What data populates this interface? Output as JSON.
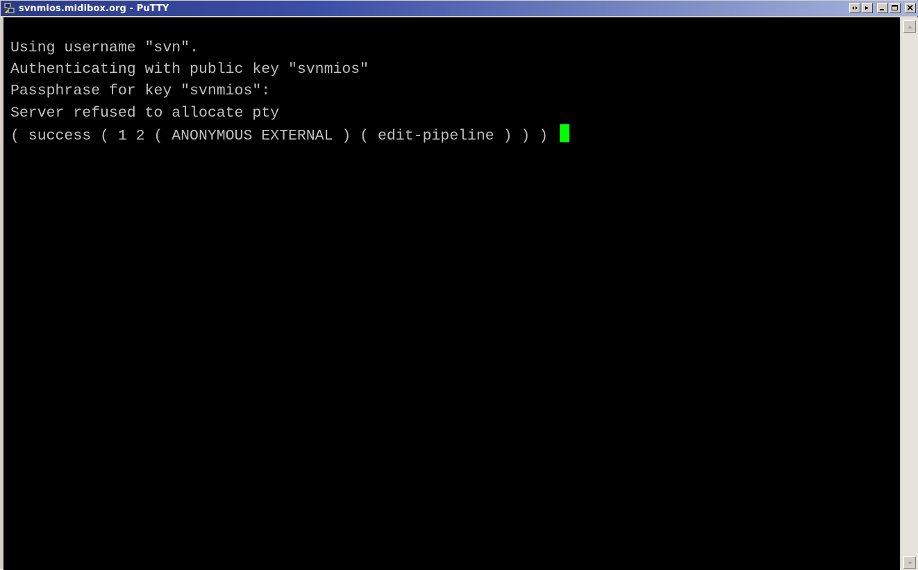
{
  "window": {
    "title": "svnmios.midibox.org - PuTTY",
    "app_icon": "putty-icon",
    "buttons": [
      "keep-on-top-icon",
      "roll-up-icon",
      "minimize-icon",
      "maximize-icon",
      "close-icon"
    ]
  },
  "terminal": {
    "background": "#000000",
    "foreground": "#c0c0c0",
    "cursor_color": "#00ff00",
    "lines": [
      "Using username \"svn\".",
      "Authenticating with public key \"svnmios\"",
      "Passphrase for key \"svnmios\":",
      "Server refused to allocate pty",
      "( success ( 1 2 ( ANONYMOUS EXTERNAL ) ( edit-pipeline ) ) ) "
    ]
  },
  "scrollbar": {
    "up_icon": "scroll-up-arrow-icon",
    "down_icon": "scroll-down-arrow-icon"
  }
}
